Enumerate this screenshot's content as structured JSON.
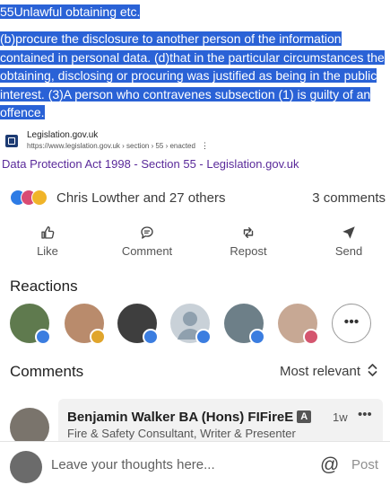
{
  "snippet": {
    "title": "55Unlawful obtaining etc.",
    "body": "(b)procure the disclosure to another person of the information contained in personal data. (d)that in the particular circumstances the obtaining, disclosing or procuring was justified as being in the public interest. (3)A person who contravenes subsection (1) is guilty of an offence."
  },
  "source": {
    "name": "Legislation.gov.uk",
    "url": "https://www.legislation.gov.uk › section › 55 › enacted",
    "menu_glyph": "⋮",
    "result_title": "Data Protection Act 1998 - Section 55 - Legislation.gov.uk",
    "favicon_color": "#1d3b73",
    "link_color": "#5a2a9a"
  },
  "social": {
    "reactors": "Chris Lowther and 27 others",
    "comments_count": "3 comments",
    "reaction_icons": [
      "like-reaction-icon",
      "love-reaction-icon",
      "insightful-reaction-icon"
    ]
  },
  "actions": [
    {
      "label": "Like",
      "icon": "thumbs-up-icon"
    },
    {
      "label": "Comment",
      "icon": "comment-icon"
    },
    {
      "label": "Repost",
      "icon": "repost-icon"
    },
    {
      "label": "Send",
      "icon": "send-icon"
    }
  ],
  "reactions_section": {
    "title": "Reactions",
    "more_glyph": "•••",
    "avatars": [
      {
        "badge": "like"
      },
      {
        "badge": "insightful"
      },
      {
        "badge": "like"
      },
      {
        "badge": "like"
      },
      {
        "badge": "like"
      },
      {
        "badge": "love"
      }
    ]
  },
  "comments_section": {
    "title": "Comments",
    "sort_label": "Most relevant",
    "comments": [
      {
        "author": "Benjamin Walker BA (Hons) FIFireE",
        "badge": "A",
        "time": "1w",
        "menu_glyph": "•••",
        "headline": "Fire & Safety Consultant, Writer & Presenter"
      }
    ]
  },
  "composer": {
    "placeholder": "Leave your thoughts here...",
    "mention_glyph": "@",
    "post_label": "Post"
  },
  "colors": {
    "highlight": "#2a62d6",
    "like_badge": "#3b7de0",
    "insightful_badge": "#e0a52c",
    "love_badge": "#d4566f"
  }
}
